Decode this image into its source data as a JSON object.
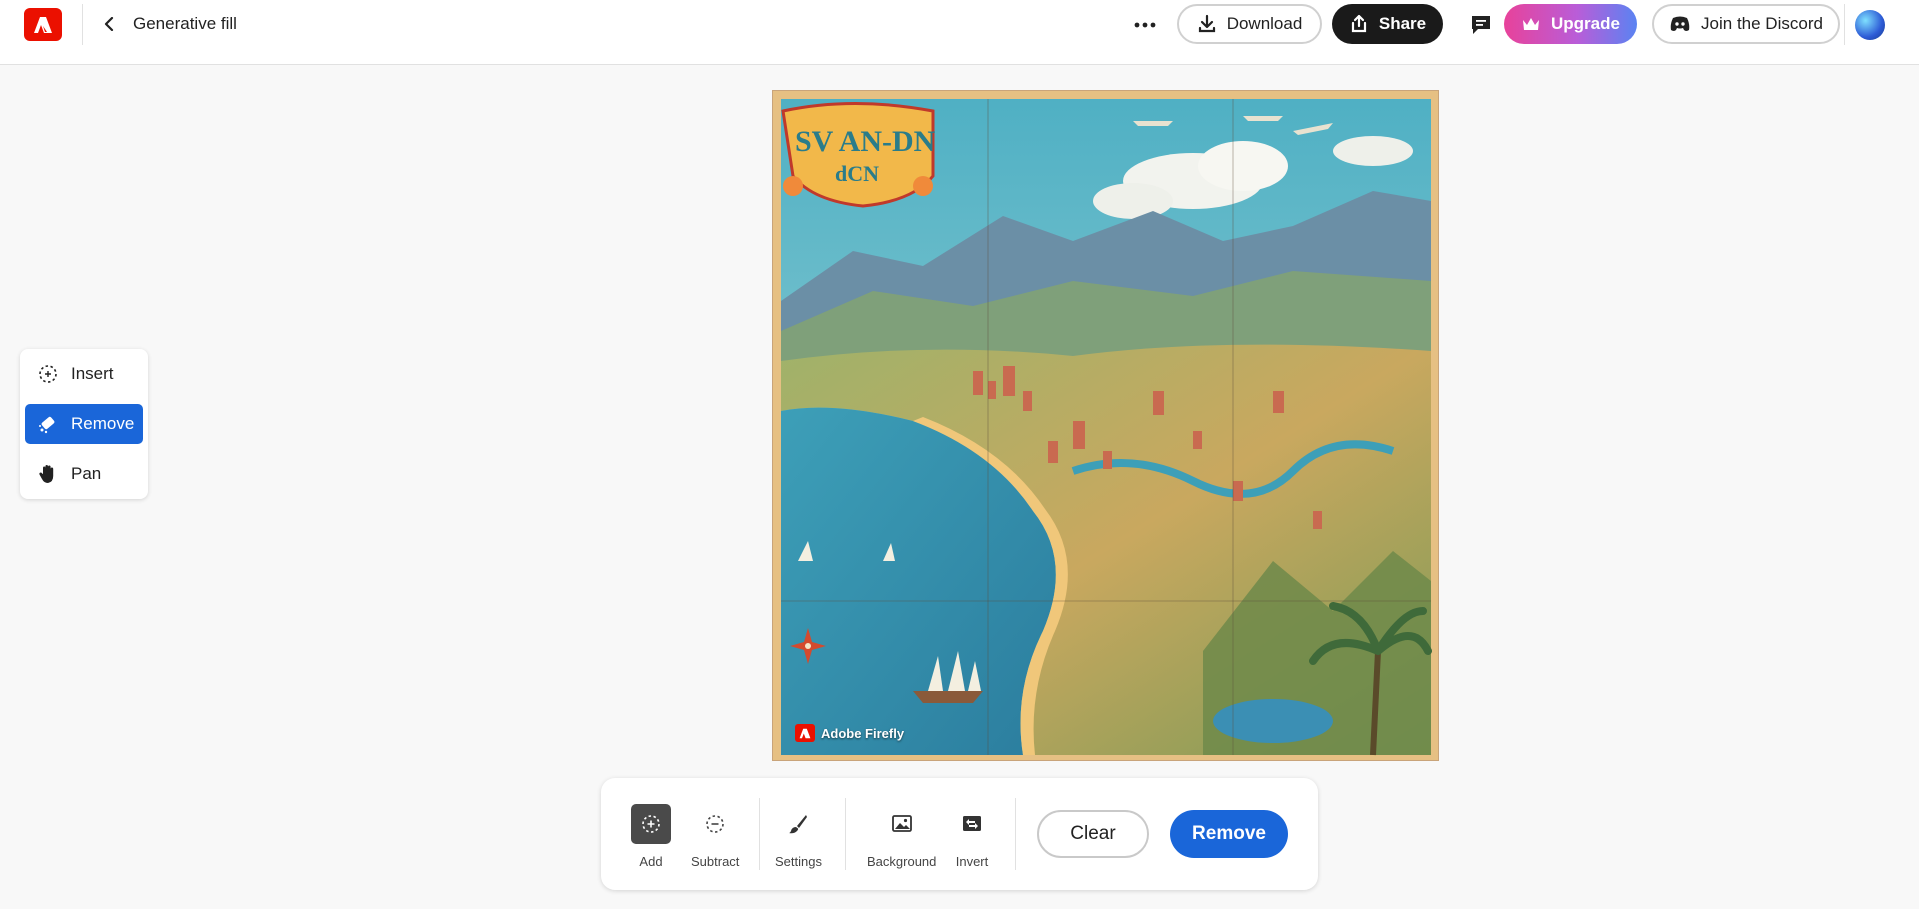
{
  "header": {
    "title": "Generative fill",
    "download_label": "Download",
    "share_label": "Share",
    "upgrade_label": "Upgrade",
    "discord_label": "Join the Discord"
  },
  "icons": {
    "back": "chevron-left-icon",
    "more": "more-horizontal-icon",
    "download": "download-icon",
    "share": "share-icon",
    "comment": "comment-icon",
    "upgrade": "crown-icon",
    "discord": "discord-icon"
  },
  "tool_panel": {
    "items": [
      {
        "label": "Insert",
        "active": false,
        "icon": "insert-icon"
      },
      {
        "label": "Remove",
        "active": true,
        "icon": "remove-eraser-icon"
      },
      {
        "label": "Pan",
        "active": false,
        "icon": "hand-icon"
      }
    ]
  },
  "canvas": {
    "map_title_line1": "SV AN-DN",
    "map_title_line2": "dCN",
    "watermark": "Adobe Firefly"
  },
  "bottom_toolbar": {
    "add_label": "Add",
    "subtract_label": "Subtract",
    "settings_label": "Settings",
    "background_label": "Background",
    "invert_label": "Invert",
    "clear_label": "Clear",
    "remove_label": "Remove"
  },
  "colors": {
    "accent_blue": "#1a66d9",
    "adobe_red": "#eb1000",
    "share_dark": "#1a1a1a"
  }
}
